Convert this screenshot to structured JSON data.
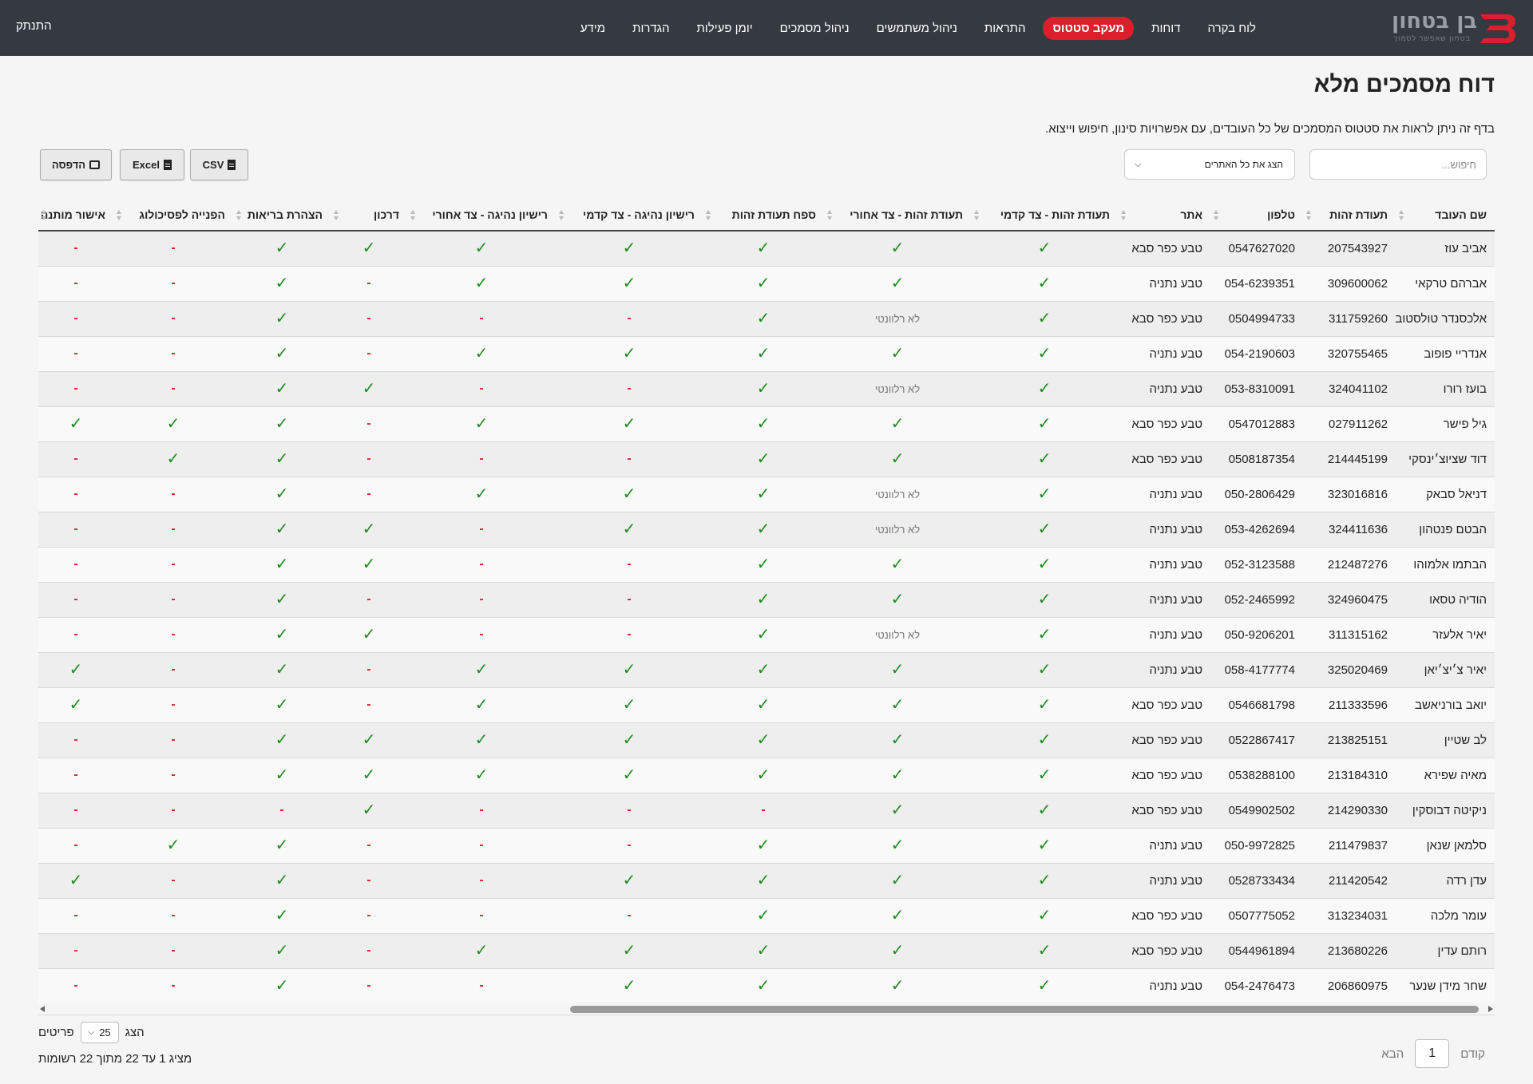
{
  "nav": {
    "logo_text": "בן בטחון",
    "logo_tagline": "בטחון שאפשר לסמוך",
    "items": [
      {
        "label": "לוח בקרה",
        "active": false
      },
      {
        "label": "דוחות",
        "active": false
      },
      {
        "label": "מעקב סטטוס",
        "active": true
      },
      {
        "label": "התראות",
        "active": false
      },
      {
        "label": "ניהול משתמשים",
        "active": false
      },
      {
        "label": "ניהול מסמכים",
        "active": false
      },
      {
        "label": "יומן פעילות",
        "active": false
      },
      {
        "label": "הגדרות",
        "active": false
      },
      {
        "label": "מידע",
        "active": false
      }
    ],
    "logout": "התנתק"
  },
  "page": {
    "title": "דוח מסמכים מלא",
    "description": "בדף זה ניתן לראות את סטטוס המסמכים של כל העובדים, עם אפשרויות סינון, חיפוש וייצוא."
  },
  "filters": {
    "search_placeholder": "חיפוש...",
    "site_select_value": "הצג את כל האתרים"
  },
  "export": {
    "csv": "CSV",
    "excel": "Excel",
    "print": "הדפסה"
  },
  "colors": {
    "accent": "#dc1e2d",
    "yes": "#1e8c1e",
    "no": "#d9242f",
    "navbar": "#343a40"
  },
  "table": {
    "columns": [
      "שם העובד",
      "תעודת זהות",
      "טלפון",
      "אתר",
      "תעודת זהות - צד קדמי",
      "תעודת זהות - צד אחורי",
      "ספח תעודת זהות",
      "רישיון נהיגה - צד קדמי",
      "רישיון נהיגה - צד אחורי",
      "דרכון",
      "הצהרת בריאות",
      "הפנייה לפסיכולוג",
      "אישור מותנה"
    ],
    "symbols": {
      "yes": "✓",
      "no": "-",
      "na": "לא רלוונטי"
    },
    "rows": [
      {
        "name": "אביב עוז",
        "id": "207543927",
        "phone": "0547627020",
        "site": "טבע כפר סבא",
        "docs": [
          "yes",
          "yes",
          "yes",
          "yes",
          "yes",
          "yes",
          "yes",
          "no",
          "no"
        ]
      },
      {
        "name": "אברהם טרקאי",
        "id": "309600062",
        "phone": "054-6239351",
        "site": "טבע נתניה",
        "docs": [
          "yes",
          "yes",
          "yes",
          "yes",
          "yes",
          "no",
          "yes",
          "no",
          "no"
        ]
      },
      {
        "name": "אלכסנדר טולסטוב",
        "id": "311759260",
        "phone": "0504994733",
        "site": "טבע כפר סבא",
        "docs": [
          "yes",
          "na",
          "yes",
          "no",
          "no",
          "no",
          "yes",
          "no",
          "no"
        ]
      },
      {
        "name": "אנדריי פופוב",
        "id": "320755465",
        "phone": "054-2190603",
        "site": "טבע נתניה",
        "docs": [
          "yes",
          "yes",
          "yes",
          "yes",
          "yes",
          "no",
          "yes",
          "no",
          "no"
        ]
      },
      {
        "name": "בועז רורו",
        "id": "324041102",
        "phone": "053-8310091",
        "site": "טבע נתניה",
        "docs": [
          "yes",
          "na",
          "yes",
          "no",
          "no",
          "yes",
          "yes",
          "no",
          "no"
        ]
      },
      {
        "name": "גיל פישר",
        "id": "027911262",
        "phone": "0547012883",
        "site": "טבע כפר סבא",
        "docs": [
          "yes",
          "yes",
          "yes",
          "yes",
          "yes",
          "no",
          "yes",
          "yes",
          "yes"
        ]
      },
      {
        "name": "דוד שציוצ׳ינסקי",
        "id": "214445199",
        "phone": "0508187354",
        "site": "טבע כפר סבא",
        "docs": [
          "yes",
          "yes",
          "yes",
          "no",
          "no",
          "no",
          "yes",
          "yes",
          "no"
        ]
      },
      {
        "name": "דניאל סבאק",
        "id": "323016816",
        "phone": "050-2806429",
        "site": "טבע נתניה",
        "docs": [
          "yes",
          "na",
          "yes",
          "yes",
          "yes",
          "no",
          "yes",
          "no",
          "no"
        ]
      },
      {
        "name": "הבטם פנטהון",
        "id": "324411636",
        "phone": "053-4262694",
        "site": "טבע נתניה",
        "docs": [
          "yes",
          "na",
          "yes",
          "yes",
          "no",
          "yes",
          "yes",
          "no",
          "no"
        ]
      },
      {
        "name": "הבתמו אלמוהו",
        "id": "212487276",
        "phone": "052-3123588",
        "site": "טבע נתניה",
        "docs": [
          "yes",
          "yes",
          "yes",
          "no",
          "no",
          "yes",
          "yes",
          "no",
          "no"
        ]
      },
      {
        "name": "הודיה טסאו",
        "id": "324960475",
        "phone": "052-2465992",
        "site": "טבע נתניה",
        "docs": [
          "yes",
          "yes",
          "yes",
          "no",
          "no",
          "no",
          "yes",
          "no",
          "no"
        ]
      },
      {
        "name": "יאיר אלעזר",
        "id": "311315162",
        "phone": "050-9206201",
        "site": "טבע נתניה",
        "docs": [
          "yes",
          "na",
          "yes",
          "no",
          "no",
          "yes",
          "yes",
          "no",
          "no"
        ]
      },
      {
        "name": "יאיר צ׳יצ׳יאן",
        "id": "325020469",
        "phone": "058-4177774",
        "site": "טבע נתניה",
        "docs": [
          "yes",
          "yes",
          "yes",
          "yes",
          "yes",
          "no",
          "yes",
          "no",
          "yes"
        ]
      },
      {
        "name": "יואב בורניאשב",
        "id": "211333596",
        "phone": "0546681798",
        "site": "טבע כפר סבא",
        "docs": [
          "yes",
          "yes",
          "yes",
          "yes",
          "yes",
          "no",
          "yes",
          "no",
          "yes"
        ]
      },
      {
        "name": "לב שטיין",
        "id": "213825151",
        "phone": "0522867417",
        "site": "טבע כפר סבא",
        "docs": [
          "yes",
          "yes",
          "yes",
          "yes",
          "yes",
          "yes",
          "yes",
          "no",
          "no"
        ]
      },
      {
        "name": "מאיה שפירא",
        "id": "213184310",
        "phone": "0538288100",
        "site": "טבע כפר סבא",
        "docs": [
          "yes",
          "yes",
          "yes",
          "yes",
          "yes",
          "yes",
          "yes",
          "no",
          "no"
        ]
      },
      {
        "name": "ניקיטה דבוסקין",
        "id": "214290330",
        "phone": "0549902502",
        "site": "טבע כפר סבא",
        "docs": [
          "yes",
          "yes",
          "no",
          "no",
          "no",
          "yes",
          "no",
          "no",
          "no"
        ]
      },
      {
        "name": "סלמאן שנאן",
        "id": "211479837",
        "phone": "050-9972825",
        "site": "טבע נתניה",
        "docs": [
          "yes",
          "yes",
          "yes",
          "no",
          "no",
          "no",
          "yes",
          "yes",
          "no"
        ]
      },
      {
        "name": "עדן רדה",
        "id": "211420542",
        "phone": "0528733434",
        "site": "טבע נתניה",
        "docs": [
          "yes",
          "yes",
          "yes",
          "yes",
          "no",
          "no",
          "yes",
          "no",
          "yes"
        ]
      },
      {
        "name": "עומר מלכה",
        "id": "313234031",
        "phone": "0507775052",
        "site": "טבע כפר סבא",
        "docs": [
          "yes",
          "yes",
          "yes",
          "no",
          "no",
          "no",
          "yes",
          "no",
          "no"
        ]
      },
      {
        "name": "רותם עדין",
        "id": "213680226",
        "phone": "0544961894",
        "site": "טבע כפר סבא",
        "docs": [
          "yes",
          "yes",
          "yes",
          "yes",
          "yes",
          "no",
          "yes",
          "no",
          "no"
        ]
      },
      {
        "name": "שחר מידן שנער",
        "id": "206860975",
        "phone": "054-2476473",
        "site": "טבע נתניה",
        "docs": [
          "yes",
          "yes",
          "yes",
          "yes",
          "no",
          "no",
          "yes",
          "no",
          "no"
        ]
      }
    ]
  },
  "footer": {
    "show_label": "הצג",
    "page_size": "25",
    "items_label": "פריטים",
    "info": "מציג 1 עד 22 מתוך 22 רשומות",
    "prev": "קודם",
    "current_page": "1",
    "next": "הבא"
  }
}
